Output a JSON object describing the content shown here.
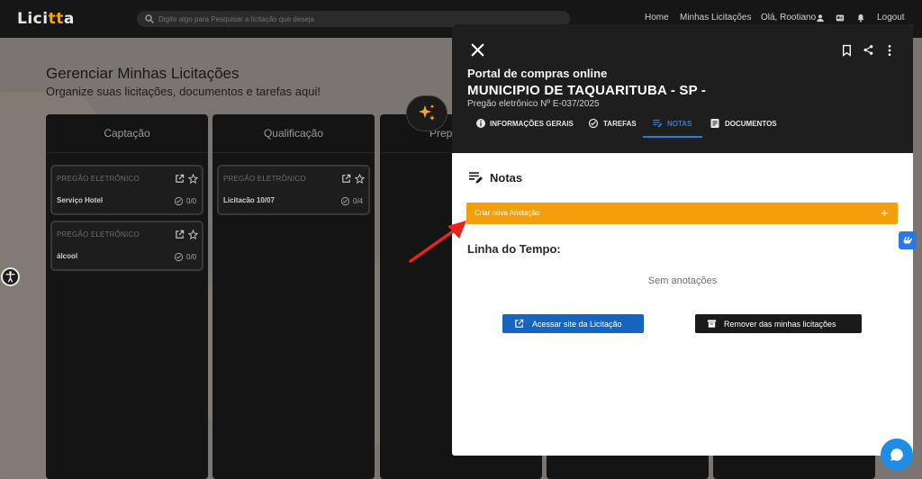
{
  "topbar": {
    "logo": "Licitta",
    "search_placeholder": "Digite algo para Pesquisar a licitação que deseja",
    "nav": {
      "home": "Home",
      "my_bids": "Minhas Licitações",
      "greeting": "Olá, Rootiano",
      "logout": "Logout"
    }
  },
  "page": {
    "title": "Gerenciar Minhas Licitações",
    "subtitle": "Organize suas licitações, documentos e tarefas aqui!",
    "columns": [
      {
        "title": "Captação",
        "cards": [
          {
            "type": "PREGÃO ELETRÔNICO",
            "name": "Serviço Hotel",
            "count": "0/0"
          },
          {
            "type": "PREGÃO ELETRÔNICO",
            "name": "álcool",
            "count": "0/0"
          }
        ]
      },
      {
        "title": "Qualificação",
        "cards": [
          {
            "type": "PREGÃO ELETRÔNICO",
            "name": "Licitacão 10/07",
            "count": "0/4"
          }
        ]
      },
      {
        "title": "Prep",
        "cards": []
      }
    ]
  },
  "panel": {
    "portal": "Portal de compras online",
    "municipality": "MUNICIPIO DE TAQUARITUBA - SP -",
    "procurement": "Pregão eletrônico Nº E-037/2025",
    "tabs": [
      {
        "label": "INFORMAÇÕES GERAIS",
        "icon": "info-icon",
        "active": false
      },
      {
        "label": "TAREFAS",
        "icon": "check-circle-icon",
        "active": false
      },
      {
        "label": "NOTAS",
        "icon": "notes-icon",
        "active": true
      },
      {
        "label": "DOCUMENTOS",
        "icon": "document-icon",
        "active": false
      }
    ],
    "notes_heading": "Notas",
    "create_note": "Criar nova Anotação",
    "create_plus": "+",
    "timeline_heading": "Linha do Tempo:",
    "empty_text": "Sem anotações",
    "btn_access": "Acessar site da Licitação",
    "btn_remove": "Remover das minhas licitações"
  },
  "colors": {
    "accent": "#f59e0b",
    "primary": "#1565c0",
    "tab_active": "#2e7bd6",
    "logo_accent": "#f3a21c"
  }
}
